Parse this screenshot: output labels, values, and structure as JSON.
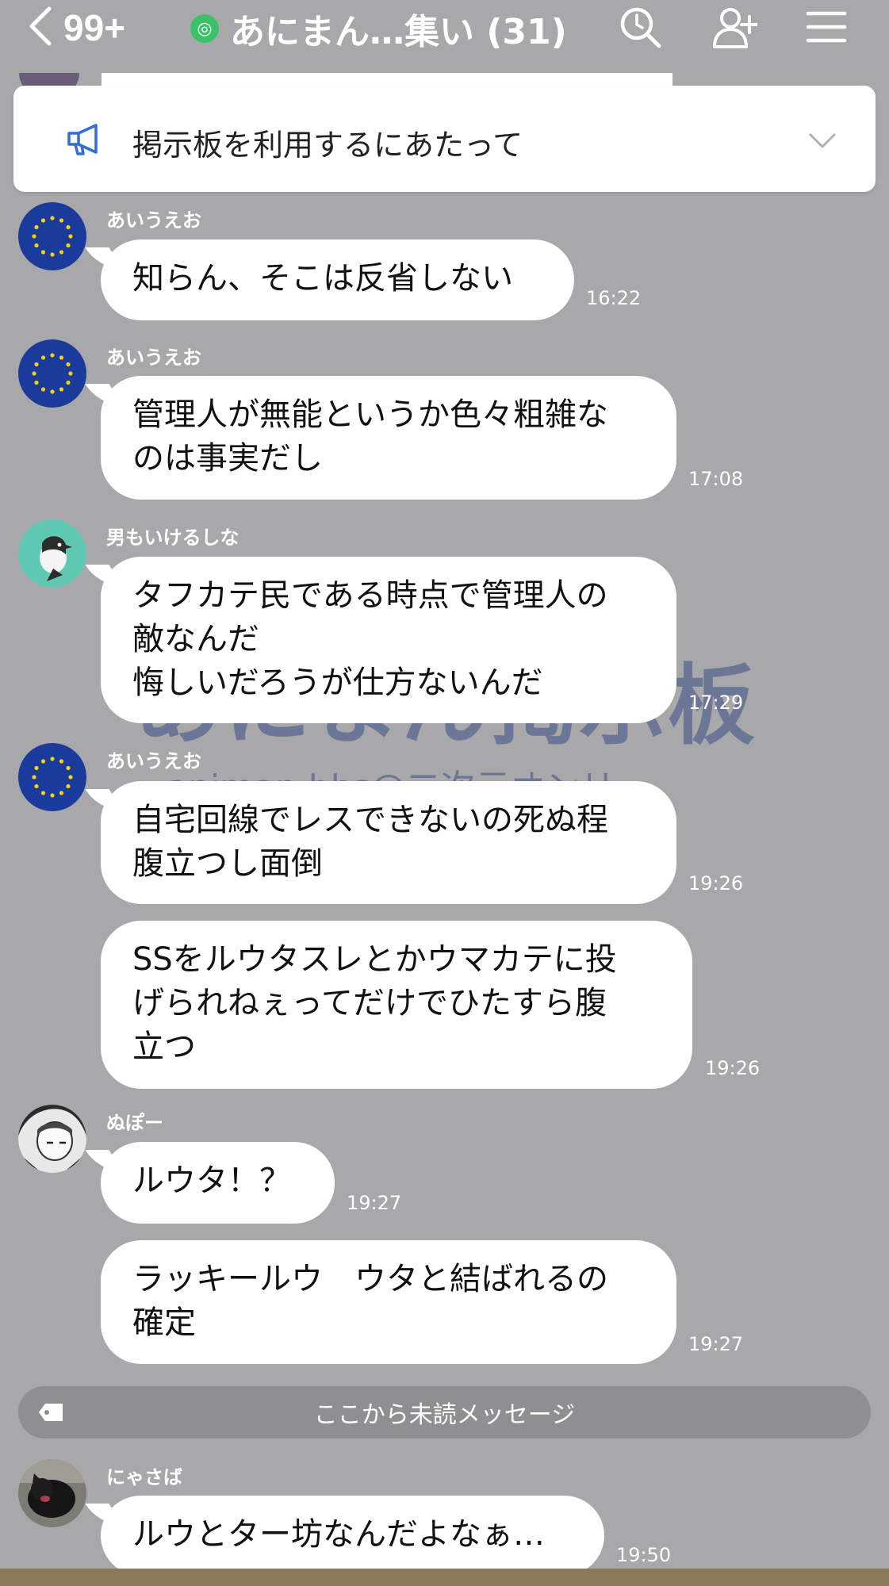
{
  "header": {
    "back_count": "99+",
    "title": "あにまん…集い (31)",
    "icons": [
      "back-chevron-icon",
      "search-icon",
      "add-friend-icon",
      "menu-icon"
    ]
  },
  "announcement": {
    "text": "掲示板を利用するにあたって"
  },
  "watermark": {
    "main": "あにまん掲示板",
    "sub": "animan.bbs@二次元オンリー"
  },
  "messages": [
    {
      "sender": "あいうえお",
      "text": "知らん、そこは反省しない",
      "time": "16:22"
    },
    {
      "sender": "あいうえお",
      "text": "管理人が無能というか色々粗雑な\nのは事実だし",
      "time": "17:08"
    },
    {
      "sender": "男もいけるしな",
      "text": "タフカテ民である時点で管理人の\n敵なんだ\n悔しいだろうが仕方ないんだ",
      "time": "17:29"
    },
    {
      "sender": "あいうえお",
      "text": "自宅回線でレスできないの死ぬ程\n腹立つし面倒",
      "time": "19:26"
    },
    {
      "sender": "",
      "text": "SSをルウタスレとかウマカテに投\nげられねぇってだけでひたすら腹\n立つ",
      "time": "19:26"
    },
    {
      "sender": "ぬぽー",
      "text": "ルウタ！？",
      "time": "19:27"
    },
    {
      "sender": "",
      "text": "ラッキールウ　ウタと結ばれるの\n確定",
      "time": "19:27"
    },
    {
      "sender": "にゃさば",
      "text": "ルウとター坊なんだよなぁ…",
      "time": "19:50"
    }
  ],
  "unread_divider": "ここから未読メッセージ",
  "colors": {
    "background": "#a8a8aa",
    "bubble": "#ffffff",
    "accent_green": "#3cc16b",
    "announce_icon": "#2f6fd6"
  }
}
